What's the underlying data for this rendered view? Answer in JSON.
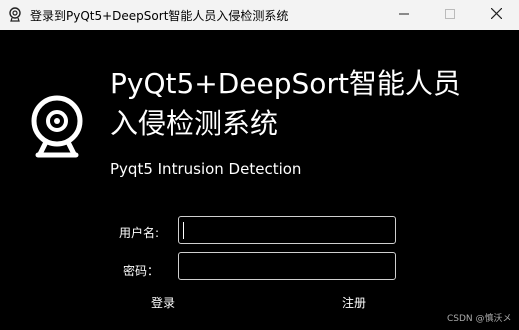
{
  "window": {
    "title": "登录到PyQt5+DeepSort智能人员入侵检测系统",
    "icon": "webcam-icon",
    "controls": [
      "minimize-icon",
      "maximize-icon",
      "close-icon"
    ]
  },
  "header": {
    "title_line1": "PyQt5+DeepSort智能人员",
    "title_line2": "入侵检测系统",
    "subtitle": "Pyqt5 Intrusion Detection",
    "logo": "webcam-icon"
  },
  "form": {
    "username_label": "用户名:",
    "username_value": "",
    "password_label": "密码：",
    "password_value": "",
    "login_label": "登录",
    "register_label": "注册"
  },
  "watermark": "CSDN @慎沃メ",
  "colors": {
    "background": "#000000",
    "titlebar": "#f3f3f3",
    "text": "#ffffff",
    "field_border": "#cfcfcf"
  }
}
